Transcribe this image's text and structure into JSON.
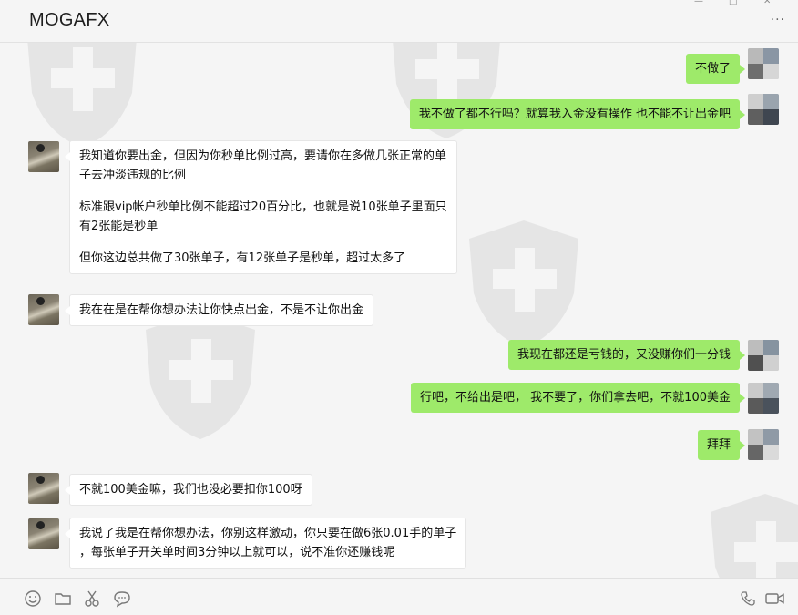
{
  "window": {
    "title": "MOGAFX",
    "more_icon": "more-dots-icon"
  },
  "messages": [
    {
      "side": "right",
      "text": "不做了"
    },
    {
      "side": "right",
      "text": "我不做了都不行吗？就算我入金没有操作 也不能不让出金吧"
    },
    {
      "side": "left",
      "paragraphs": [
        {
          "lines": [
            "我知道你要出金，但因为你秒单比例过高，要请你在多做几张正常的单",
            "子去冲淡违规的比例"
          ]
        },
        {
          "lines": [
            "标准跟vip帐户秒单比例不能超过20百分比，也就是说10张单子里面只",
            "有2张能是秒单"
          ]
        },
        {
          "lines": [
            "但你这边总共做了30张单子，有12张单子是秒单，超过太多了"
          ]
        }
      ]
    },
    {
      "side": "left",
      "text": "我在在是在帮你想办法让你快点出金，不是不让你出金"
    },
    {
      "side": "right",
      "text": "我现在都还是亏钱的，又没赚你们一分钱"
    },
    {
      "side": "right",
      "text": "行吧，不给出是吧， 我不要了，你们拿去吧，不就100美金"
    },
    {
      "side": "right",
      "text": "拜拜"
    },
    {
      "side": "left",
      "text": "不就100美金嘛，我们也没必要扣你100呀"
    },
    {
      "side": "left",
      "lines": [
        "我说了我是在帮你想办法，你别这样激动，你只要在做6张0.01手的单子",
        "，每张单子开关单时间3分钟以上就可以，说不准你还赚钱呢"
      ]
    }
  ],
  "toolbar": {
    "left": [
      "emoji-icon",
      "folder-icon",
      "scissors-icon",
      "chat-bubble-icon"
    ],
    "right": [
      "phone-icon",
      "video-call-icon"
    ]
  }
}
